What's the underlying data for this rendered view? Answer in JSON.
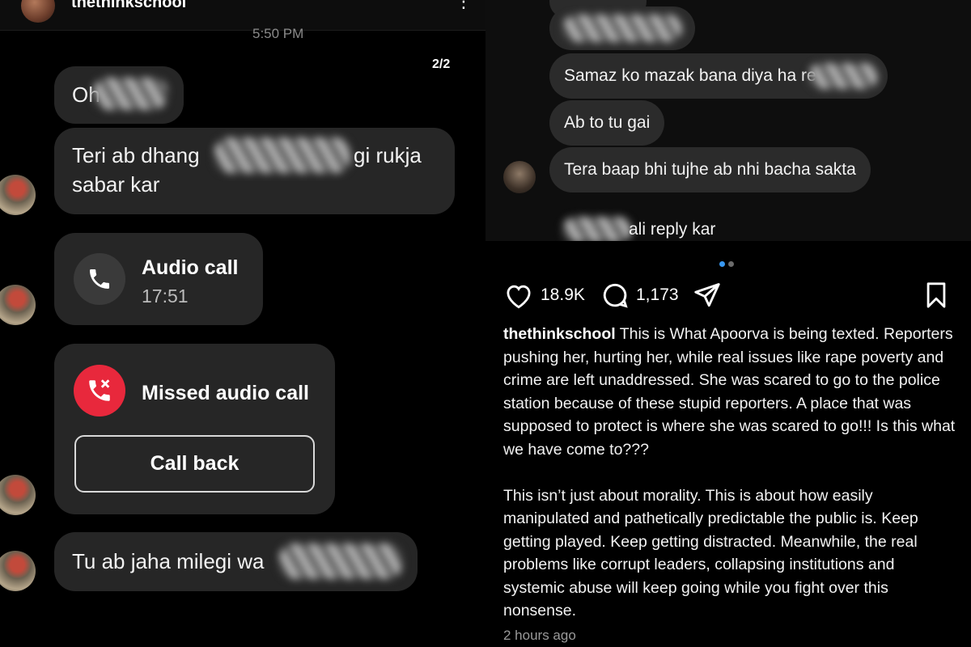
{
  "left_chat": {
    "header": {
      "username": "thethinkschool"
    },
    "timestamp": "5:50 PM",
    "pager": "2/2",
    "messages": [
      {
        "text_visible": "Oh"
      },
      {
        "text_start": "Teri ab dhang",
        "text_end": "gi rukja",
        "line2": "sabar kar"
      },
      {
        "text_visible": "Tu ab jaha milegi wa"
      }
    ],
    "audio_call": {
      "title": "Audio call",
      "time": "17:51"
    },
    "missed_call": {
      "title": "Missed audio call",
      "button": "Call back"
    }
  },
  "right_chat": {
    "messages": [
      {
        "text": "Samaz ko mazak bana diya ha re"
      },
      {
        "text": "Ab to tu gai"
      },
      {
        "text": "Tera baap bhi tujhe ab nhi bacha sakta"
      },
      {
        "text_visible": "ali reply kar"
      }
    ]
  },
  "post": {
    "likes": "18.9K",
    "comments": "1,173",
    "author": "thethinkschool",
    "caption_p1": " This is What Apoorva is being texted. Reporters pushing her, hurting her, while real issues like rape poverty and crime are left unaddressed. She was scared to go to the police station because of these stupid reporters. A place that was supposed to protect is where she was scared to go!!! Is this what we have come to???",
    "caption_p2": "This isn’t just about morality. This is about how easily manipulated and pathetically predictable the public is. Keep getting played. Keep getting distracted. Meanwhile, the real problems like corrupt leaders, collapsing institutions and systemic abuse will keep going while you fight over this nonsense.",
    "time_ago": "2 hours ago",
    "icons": {
      "like": "heart-icon",
      "comment": "comment-icon",
      "share": "send-icon",
      "save": "bookmark-icon"
    }
  },
  "colors": {
    "bubble": "#262626",
    "missed_red": "#e8283c",
    "call_gray": "#3a3a3a",
    "dot_active": "#3897f0"
  }
}
